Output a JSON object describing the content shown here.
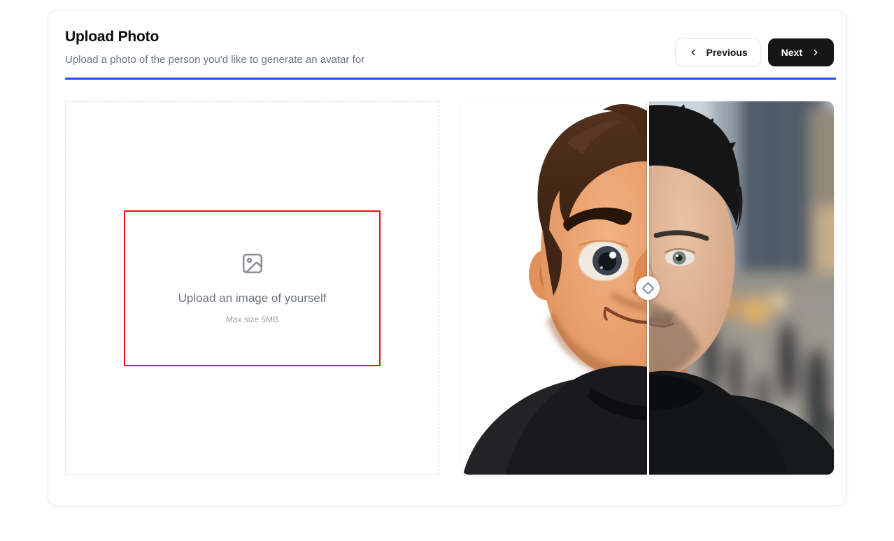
{
  "header": {
    "title": "Upload Photo",
    "subtitle": "Upload a photo of the person you'd like to generate an avatar for"
  },
  "nav": {
    "previous_label": "Previous",
    "previous_icon": "chevron-left-icon",
    "next_label": "Next",
    "next_icon": "chevron-right-icon"
  },
  "uploader": {
    "label": "Upload an image of yourself",
    "hint": "Max size 5MB",
    "icon": "image-placeholder-icon"
  },
  "comparison": {
    "left_content": "cartoon-3d-avatar-preview",
    "right_content": "original-photo-of-man",
    "handle_icon": "diamond-icon",
    "slider_position_percent": 50
  },
  "colors": {
    "accent_blue": "#1a50e6",
    "highlight_red": "#ee1111",
    "primary_button_bg": "#161616",
    "muted_text": "#6b7280",
    "hint_text": "#9aa0a8"
  }
}
